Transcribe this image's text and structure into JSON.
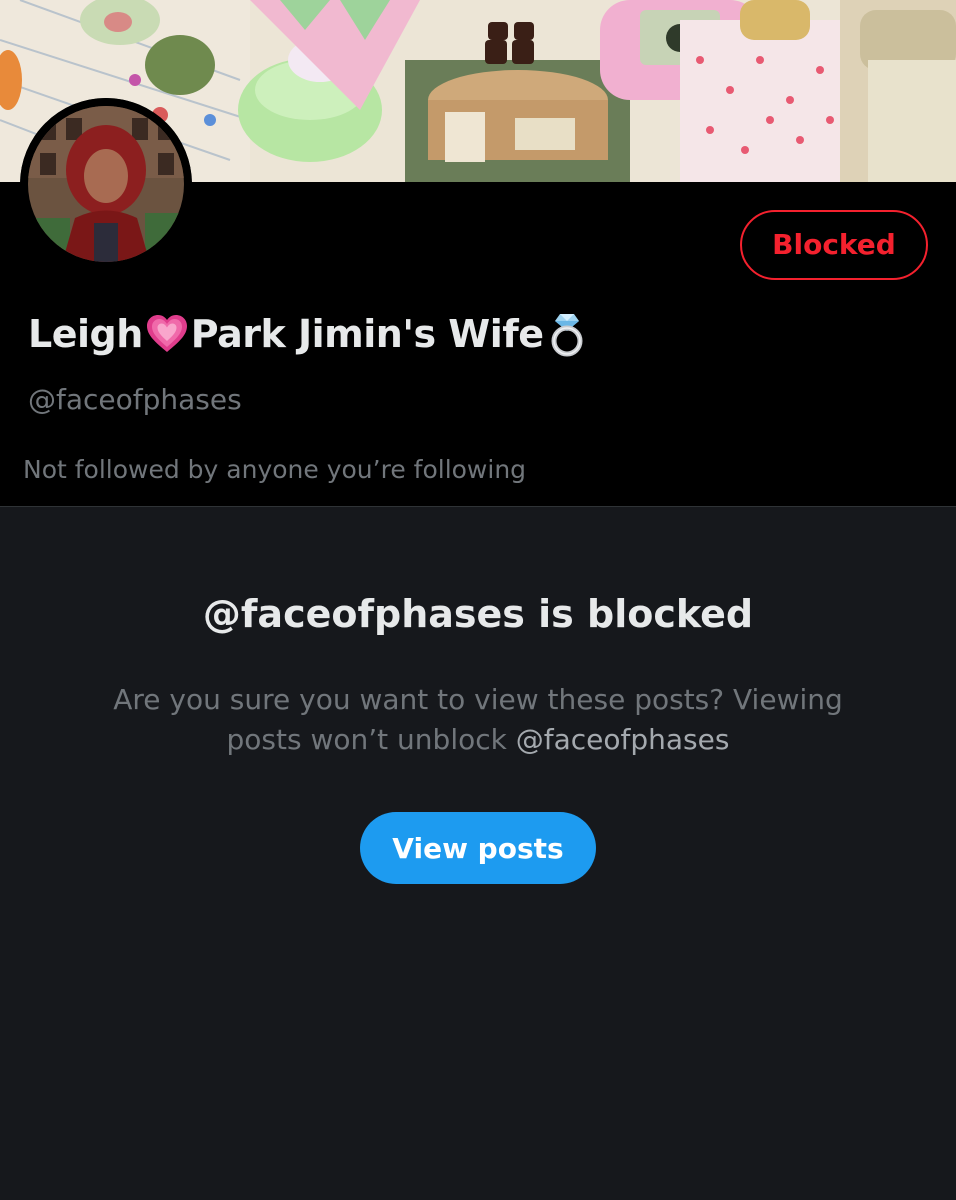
{
  "profile": {
    "name_part1": "Leigh",
    "name_emoji1": "heart-icon",
    "name_part2": "Park Jimin's Wife",
    "name_emoji2": "ring-icon",
    "handle": "@faceofphases",
    "follow_context": "Not followed by anyone you’re following",
    "blocked_button": "Blocked"
  },
  "blocked_notice": {
    "title": "@faceofphases is blocked",
    "description_prefix": "Are you sure you want to view these posts? Viewing posts won’t unblock ",
    "description_handle": "@faceofphases",
    "view_posts_button": "View posts"
  },
  "colors": {
    "background": "#000000",
    "panel": "#16181c",
    "primary_text": "#e7e9ea",
    "secondary_text": "#71767b",
    "blocked_red": "#f4212e",
    "accent_blue": "#1d9bf0",
    "divider": "#2f3336"
  }
}
